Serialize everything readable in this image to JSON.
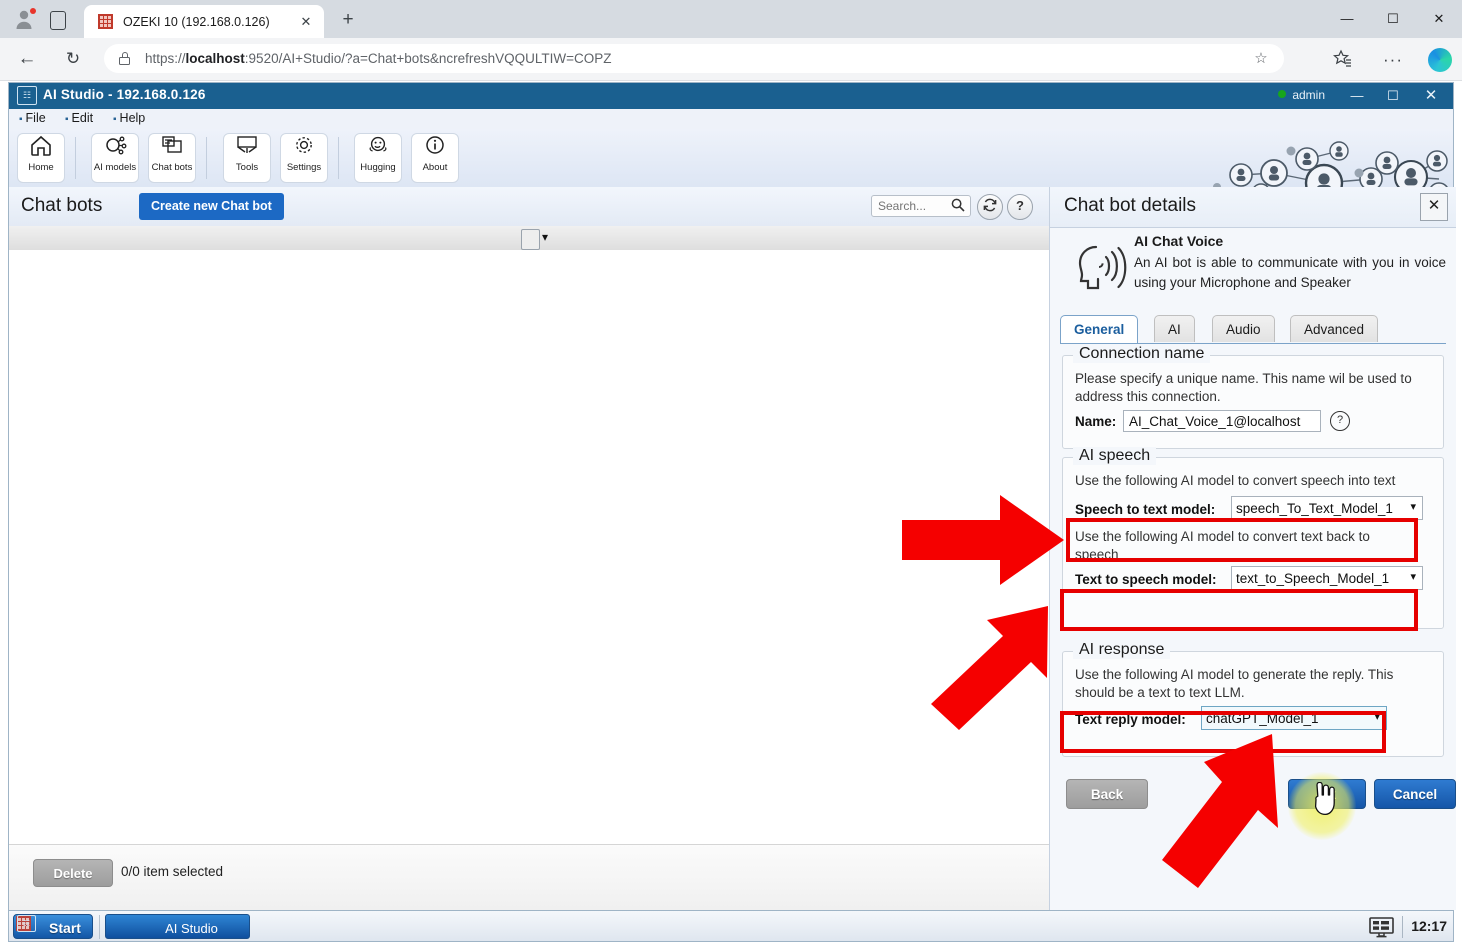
{
  "browser": {
    "tab": {
      "title": "OZEKI 10 (192.168.0.126)",
      "close_label": "✕"
    },
    "new_tab_label": "+",
    "url_prefix": "https://",
    "url_host": "localhost",
    "url_rest": ":9520/AI+Studio/?a=Chat+bots&ncrefreshVQQULTIW=COPZ",
    "window_controls": {
      "minimize": "—",
      "maximize": "☐",
      "close": "✕"
    },
    "back_label": "←",
    "reload_label": "↻",
    "star_label": "☆",
    "collections_label": "☆",
    "more_label": "···"
  },
  "app": {
    "title": "AI Studio - 192.168.0.126",
    "user": "admin",
    "window_controls": {
      "minimize": "—",
      "maximize": "☐",
      "close": "✕"
    },
    "menu": [
      "File",
      "Edit",
      "Help"
    ],
    "toolbar_buttons": [
      {
        "label": "Home",
        "icon": "home-icon",
        "glyph": "⌂"
      },
      {
        "label": "AI models",
        "icon": "ai-models-icon",
        "glyph": "⚙"
      },
      {
        "label": "Chat bots",
        "icon": "chat-bots-icon",
        "glyph": "⧉"
      },
      {
        "label": "Tools",
        "icon": "tools-icon",
        "glyph": "⚒"
      },
      {
        "label": "Settings",
        "icon": "settings-icon",
        "glyph": "⚙"
      },
      {
        "label": "Hugging",
        "icon": "hugging-face-icon",
        "glyph": "☺"
      },
      {
        "label": "About",
        "icon": "about-info-icon",
        "glyph": "ⓘ"
      }
    ]
  },
  "left_panel": {
    "title": "Chat bots",
    "create_button": "Create new Chat bot",
    "search_placeholder": "Search...",
    "search_value": "",
    "refresh_label": "↻",
    "help_label": "?",
    "delete_button": "Delete",
    "selection_status": "0/0 item selected"
  },
  "right_panel": {
    "title": "Chat bot details",
    "close_label": "✕",
    "bot_name": "AI Chat Voice",
    "bot_description": "An AI bot is able to communicate with you in voice using your Microphone and Speaker",
    "tabs": [
      {
        "label": "General",
        "active": true
      },
      {
        "label": "AI",
        "active": false
      },
      {
        "label": "Audio",
        "active": false
      },
      {
        "label": "Advanced",
        "active": false
      }
    ],
    "connection_name": {
      "legend": "Connection name",
      "description": "Please specify a unique name. This name wil be used to address this connection.",
      "name_label": "Name:",
      "name_value": "AI_Chat_Voice_1@localhost",
      "help_label": "?"
    },
    "ai_speech": {
      "legend": "AI speech",
      "stt_description": "Use the following AI model to convert speech into text",
      "stt_label": "Speech to text model:",
      "stt_value": "speech_To_Text_Model_1",
      "tts_description": "Use the following AI model to convert text back to speech",
      "tts_label": "Text to speech model:",
      "tts_value": "text_to_Speech_Model_1"
    },
    "ai_response": {
      "legend": "AI response",
      "description": "Use the following AI model to generate the reply. This should be a text to text LLM.",
      "reply_label": "Text reply model:",
      "reply_value": "chatGPT_Model_1"
    },
    "buttons": {
      "back": "Back",
      "ok": "Ok",
      "cancel": "Cancel"
    }
  },
  "taskbar": {
    "start": "Start",
    "task_item": "AI Studio",
    "clock": "12:17"
  },
  "colors": {
    "accent_blue": "#1c69c4",
    "titlebar_blue": "#1a6090",
    "annotation_red": "#e60000",
    "status_green": "#17a51c"
  }
}
